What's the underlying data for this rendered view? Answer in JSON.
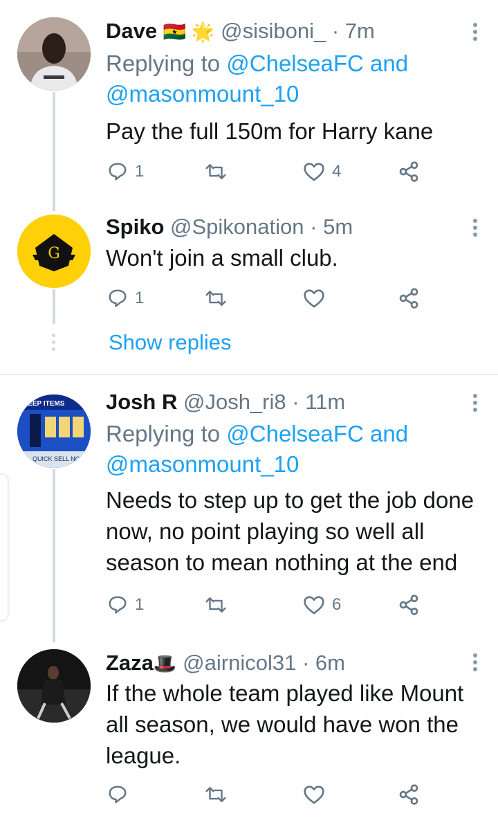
{
  "tweets": [
    {
      "name": "Dave",
      "emoji": "🇬🇭 🌟",
      "handle": "@sisiboni_",
      "dot": "·",
      "time": "7m",
      "replying_prefix": "Replying to ",
      "replying_mention_1": "@ChelseaFC",
      "replying_and": " and",
      "replying_mention_2": "@masonmount_10",
      "text": "Pay the full 150m for Harry kane",
      "reply_count": "1",
      "retweet_count": "",
      "like_count": "4"
    },
    {
      "name": "Spiko",
      "handle": "@Spikonation",
      "dot": "·",
      "time": "5m",
      "text": "Won't join a small club.",
      "reply_count": "1",
      "retweet_count": "",
      "like_count": ""
    },
    {
      "name": "Josh R",
      "handle": "@Josh_ri8",
      "dot": "·",
      "time": "11m",
      "replying_prefix": "Replying to ",
      "replying_mention_1": "@ChelseaFC",
      "replying_and": " and",
      "replying_mention_2": "@masonmount_10",
      "text_lines": [
        "Needs to step up to get the job done",
        "now, no point playing so well all",
        "season to mean nothing at the end"
      ],
      "reply_count": "1",
      "retweet_count": "",
      "like_count": "6"
    },
    {
      "name": "Zaza",
      "emoji": "🎩",
      "handle": "@airnicol31",
      "dot": "·",
      "time": "6m",
      "text_lines": [
        "If the whole team played like Mount",
        "all season, we would have won the",
        "league."
      ],
      "reply_count": "",
      "retweet_count": "",
      "like_count": ""
    }
  ],
  "show_replies_label": "Show replies",
  "avatar_badges": {
    "spiko_letter": "G",
    "josh_top": "KEEP ITEMS",
    "josh_bottom": "QUICK SELL NOW"
  },
  "colors": {
    "link_blue": "#1da1f2",
    "secondary_gray": "#657786",
    "text_dark": "#14171a",
    "spiko_yellow": "#fdd007"
  }
}
